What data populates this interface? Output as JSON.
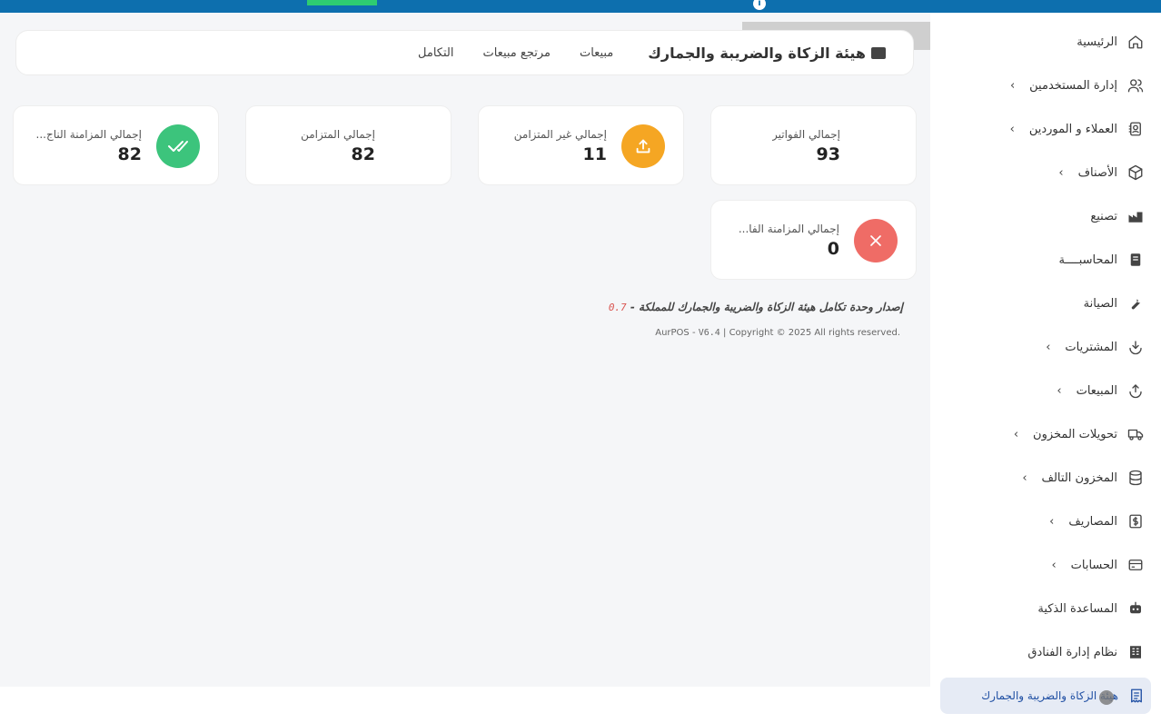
{
  "header": {
    "brand": "هيئة الزكاة والضريبة والجمارك",
    "tabs": [
      "مبيعات",
      "مرتجع مبيعات",
      "التكامل"
    ]
  },
  "stats": [
    {
      "title": "إجمالي الفواتير",
      "value": "93"
    },
    {
      "title": "إجمالي غير المتزامن",
      "value": "11",
      "icon": "upload-icon",
      "color": "#f5a623"
    },
    {
      "title": "إجمالي المتزامن",
      "value": "82"
    },
    {
      "title": "إجمالي المزامنة الناج...",
      "value": "82",
      "icon": "double-check-icon",
      "color": "#3cc47c"
    },
    {
      "title": "إجمالي المزامنة الفا...",
      "value": "0",
      "icon": "close-icon",
      "color": "#ef6c66"
    }
  ],
  "footer": {
    "title": "إصدار وحدة تكامل هيئة الزكاة والضريبة والجمارك للمملكة -",
    "version": "0.7",
    "copyright_prefix": "AurPOS - ",
    "copyright_version": "V6.4",
    "copyright_suffix": " | Copyright © 2025 All rights reserved."
  },
  "sidebar": {
    "items": [
      {
        "label": "الرئيسية",
        "icon": "home-icon",
        "chevron": false
      },
      {
        "label": "إدارة المستخدمين",
        "icon": "users-icon",
        "chevron": true
      },
      {
        "label": "العملاء و الموردين",
        "icon": "contacts-icon",
        "chevron": true
      },
      {
        "label": "الأصناف",
        "icon": "box-icon",
        "chevron": true
      },
      {
        "label": "تصنيع",
        "icon": "factory-icon",
        "chevron": false
      },
      {
        "label": "المحاسبــــة",
        "icon": "ledger-icon",
        "chevron": false
      },
      {
        "label": "الصيانة",
        "icon": "wrench-icon",
        "chevron": false
      },
      {
        "label": "المشتريات",
        "icon": "download-icon",
        "chevron": true
      },
      {
        "label": "المبيعات",
        "icon": "upload-icon",
        "chevron": true
      },
      {
        "label": "تحويلات المخزون",
        "icon": "truck-icon",
        "chevron": true
      },
      {
        "label": "المخزون التالف",
        "icon": "database-icon",
        "chevron": true
      },
      {
        "label": "المصاريف",
        "icon": "dollar-icon",
        "chevron": true
      },
      {
        "label": "الحسابات",
        "icon": "card-icon",
        "chevron": true
      },
      {
        "label": "المساعدة الذكية",
        "icon": "robot-icon",
        "chevron": false
      },
      {
        "label": "نظام إدارة الفنادق",
        "icon": "building-icon",
        "chevron": false
      },
      {
        "label": "هيئة الزكاة والضريبة والجمارك",
        "icon": "receipt-icon",
        "chevron": false,
        "active": true
      }
    ],
    "chevron_glyph": "‹"
  },
  "colors": {
    "topbar": "#0d6fae",
    "active_bg": "#e6ebf5",
    "active_text": "#1f4fa3"
  }
}
